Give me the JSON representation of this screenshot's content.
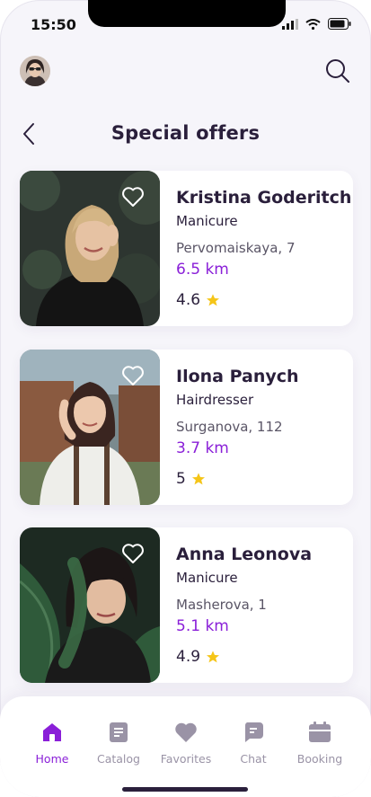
{
  "status_bar": {
    "time": "15:50"
  },
  "header": {
    "title": "Special offers"
  },
  "offers": [
    {
      "name": "Kristina Goderitch",
      "service": "Manicure",
      "address": "Pervomaiskaya, 7",
      "distance": "6.5 km",
      "rating": "4.6"
    },
    {
      "name": "Ilona Panych",
      "service": "Hairdresser",
      "address": "Surganova, 112",
      "distance": "3.7 km",
      "rating": "5"
    },
    {
      "name": "Anna Leonova",
      "service": "Manicure",
      "address": "Masherova, 1",
      "distance": "5.1 km",
      "rating": "4.9"
    }
  ],
  "nav": [
    {
      "label": "Home",
      "icon": "home-icon",
      "active": true
    },
    {
      "label": "Catalog",
      "icon": "catalog-icon"
    },
    {
      "label": "Favorites",
      "icon": "heart-icon"
    },
    {
      "label": "Chat",
      "icon": "chat-icon"
    },
    {
      "label": "Booking",
      "icon": "calendar-icon"
    }
  ],
  "colors": {
    "accent": "#8a1fd8",
    "text": "#2a1f3b",
    "star": "#f5c518",
    "nav_inactive": "#9a93a6"
  }
}
